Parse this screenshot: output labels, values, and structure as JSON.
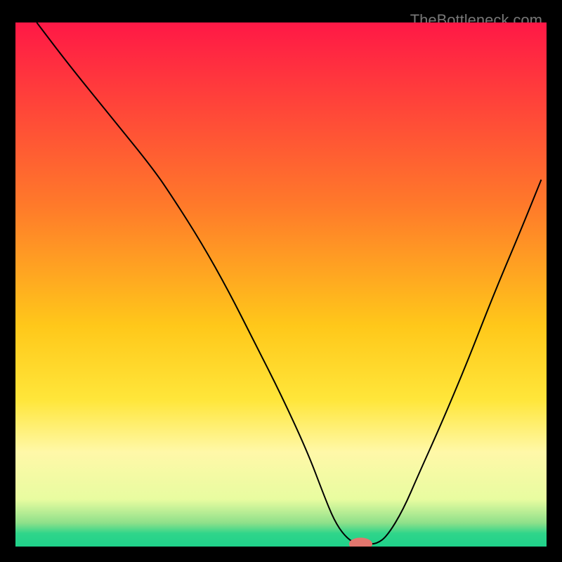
{
  "watermark": "TheBottleneck.com",
  "chart_data": {
    "type": "line",
    "title": "",
    "xlabel": "",
    "ylabel": "",
    "xlim": [
      0,
      100
    ],
    "ylim": [
      0,
      100
    ],
    "gradient_stops": [
      {
        "offset": 0.0,
        "color": "#ff1846"
      },
      {
        "offset": 0.35,
        "color": "#ff7a2a"
      },
      {
        "offset": 0.58,
        "color": "#ffc81a"
      },
      {
        "offset": 0.72,
        "color": "#ffe63a"
      },
      {
        "offset": 0.82,
        "color": "#fff8a8"
      },
      {
        "offset": 0.91,
        "color": "#e8fca0"
      },
      {
        "offset": 0.955,
        "color": "#8ee08a"
      },
      {
        "offset": 0.975,
        "color": "#2fd58a"
      },
      {
        "offset": 1.0,
        "color": "#1fd18a"
      }
    ],
    "series": [
      {
        "name": "bottleneck-curve",
        "x": [
          4,
          10,
          18,
          26,
          30,
          35,
          40,
          45,
          50,
          55,
          58,
          60,
          62,
          64,
          66,
          68,
          70,
          73,
          76,
          80,
          85,
          90,
          95,
          99
        ],
        "y": [
          100,
          92,
          82,
          72,
          66,
          58,
          49,
          39,
          29,
          18,
          10,
          5,
          2,
          0.5,
          0.5,
          0.5,
          2,
          7,
          14,
          23,
          35,
          48,
          60,
          70
        ]
      }
    ],
    "marker": {
      "x": 65,
      "y": 0.5,
      "rx": 2.2,
      "ry": 1.2,
      "color": "#e2766e"
    }
  }
}
